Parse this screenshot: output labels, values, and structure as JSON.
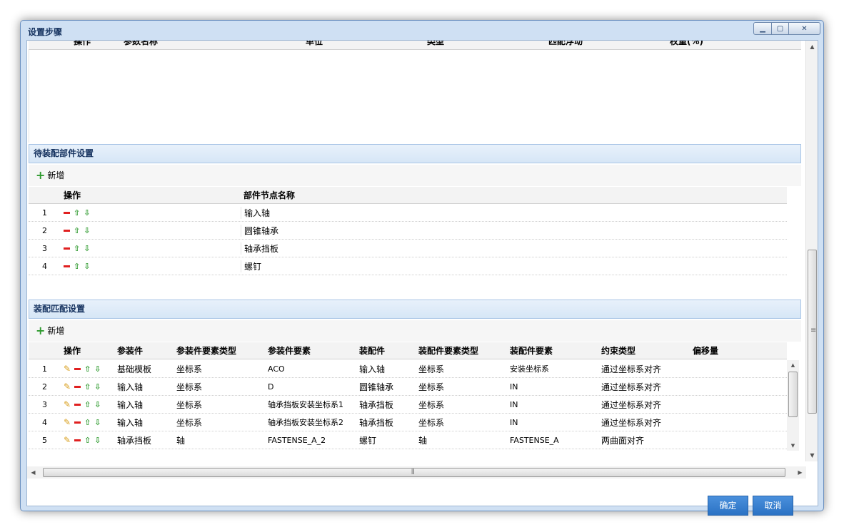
{
  "window": {
    "title": "设置步骤"
  },
  "params_table": {
    "headers": [
      "操作",
      "参数名称",
      "单位",
      "类型",
      "匹配浮动",
      "权重(%)"
    ]
  },
  "parts_section": {
    "title": "待装配部件设置",
    "add_label": "新增",
    "headers": [
      "操作",
      "部件节点名称"
    ],
    "rows": [
      {
        "no": "1",
        "name": "输入轴"
      },
      {
        "no": "2",
        "name": "圆锥轴承"
      },
      {
        "no": "3",
        "name": "轴承挡板"
      },
      {
        "no": "4",
        "name": "螺钉"
      }
    ]
  },
  "match_section": {
    "title": "装配匹配设置",
    "add_label": "新增",
    "headers": [
      "操作",
      "参装件",
      "参装件要素类型",
      "参装件要素",
      "装配件",
      "装配件要素类型",
      "装配件要素",
      "约束类型",
      "偏移量"
    ],
    "rows": [
      {
        "no": "1",
        "c1": "基础模板",
        "c2": "坐标系",
        "c3": "ACO",
        "c4": "输入轴",
        "c5": "坐标系",
        "c6": "安装坐标系",
        "c7": "通过坐标系对齐",
        "c8": ""
      },
      {
        "no": "2",
        "c1": "输入轴",
        "c2": "坐标系",
        "c3": "D",
        "c4": "圆锥轴承",
        "c5": "坐标系",
        "c6": "IN",
        "c7": "通过坐标系对齐",
        "c8": ""
      },
      {
        "no": "3",
        "c1": "输入轴",
        "c2": "坐标系",
        "c3": "轴承挡板安装坐标系1",
        "c4": "轴承挡板",
        "c5": "坐标系",
        "c6": "IN",
        "c7": "通过坐标系对齐",
        "c8": ""
      },
      {
        "no": "4",
        "c1": "输入轴",
        "c2": "坐标系",
        "c3": "轴承挡板安装坐标系2",
        "c4": "轴承挡板",
        "c5": "坐标系",
        "c6": "IN",
        "c7": "通过坐标系对齐",
        "c8": ""
      },
      {
        "no": "5",
        "c1": "轴承挡板",
        "c2": "轴",
        "c3": "FASTENSE_A_2",
        "c4": "螺钉",
        "c5": "轴",
        "c6": "FASTENSE_A",
        "c7": "两曲面对齐",
        "c8": ""
      }
    ]
  },
  "footer": {
    "ok_label": "确定",
    "cancel_label": "取消"
  },
  "icons": {
    "add": "plus-icon",
    "delete": "minus-icon",
    "up": "arrow-up-icon",
    "down": "arrow-down-icon",
    "edit": "pencil-icon"
  },
  "colors": {
    "accent": "#2b72c4",
    "header_text": "#15325f",
    "add_green": "#2e9a2e",
    "delete_red": "#e02020"
  }
}
